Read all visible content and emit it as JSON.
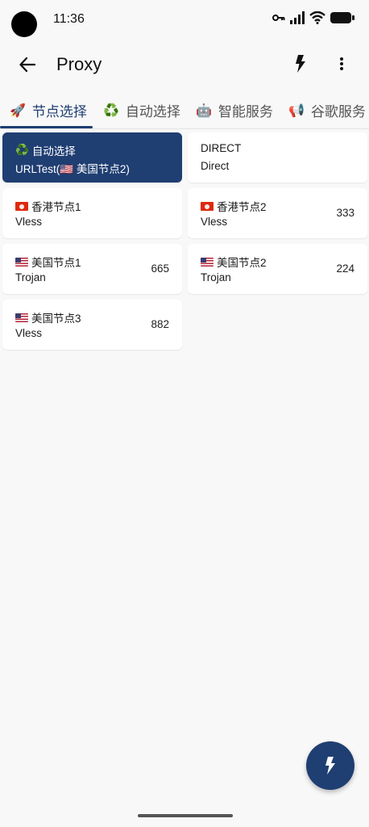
{
  "status_bar": {
    "time": "11:36"
  },
  "app_bar": {
    "title": "Proxy"
  },
  "tabs": [
    {
      "emoji": "🚀",
      "label": "节点选择",
      "active": true
    },
    {
      "emoji": "♻️",
      "label": "自动选择",
      "active": false
    },
    {
      "emoji": "🤖",
      "label": "智能服务",
      "active": false
    },
    {
      "emoji": "📢",
      "label": "谷歌服务",
      "active": false
    }
  ],
  "proxies": [
    {
      "name_emoji": "♻️",
      "name": "自动选择",
      "type": "URLTest(🇺🇸 美国节点2)",
      "delay": "",
      "selected": true
    },
    {
      "name_emoji": "",
      "name": "DIRECT",
      "type": "Direct",
      "delay": "",
      "selected": false
    },
    {
      "flag": "hk",
      "name": "香港节点1",
      "type": "Vless",
      "delay": "",
      "selected": false
    },
    {
      "flag": "hk",
      "name": "香港节点2",
      "type": "Vless",
      "delay": "333",
      "selected": false
    },
    {
      "flag": "us",
      "name": "美国节点1",
      "type": "Trojan",
      "delay": "665",
      "selected": false
    },
    {
      "flag": "us",
      "name": "美国节点2",
      "type": "Trojan",
      "delay": "224",
      "selected": false
    },
    {
      "flag": "us",
      "name": "美国节点3",
      "type": "Vless",
      "delay": "882",
      "selected": false
    }
  ],
  "colors": {
    "accent": "#1f3e72",
    "background": "#f8f8f8",
    "card": "#ffffff"
  },
  "icons": {
    "back": "arrow-left-icon",
    "test_delay": "lightning-bolt-icon",
    "more": "more-vertical-icon",
    "fab": "lightning-bolt-icon"
  }
}
